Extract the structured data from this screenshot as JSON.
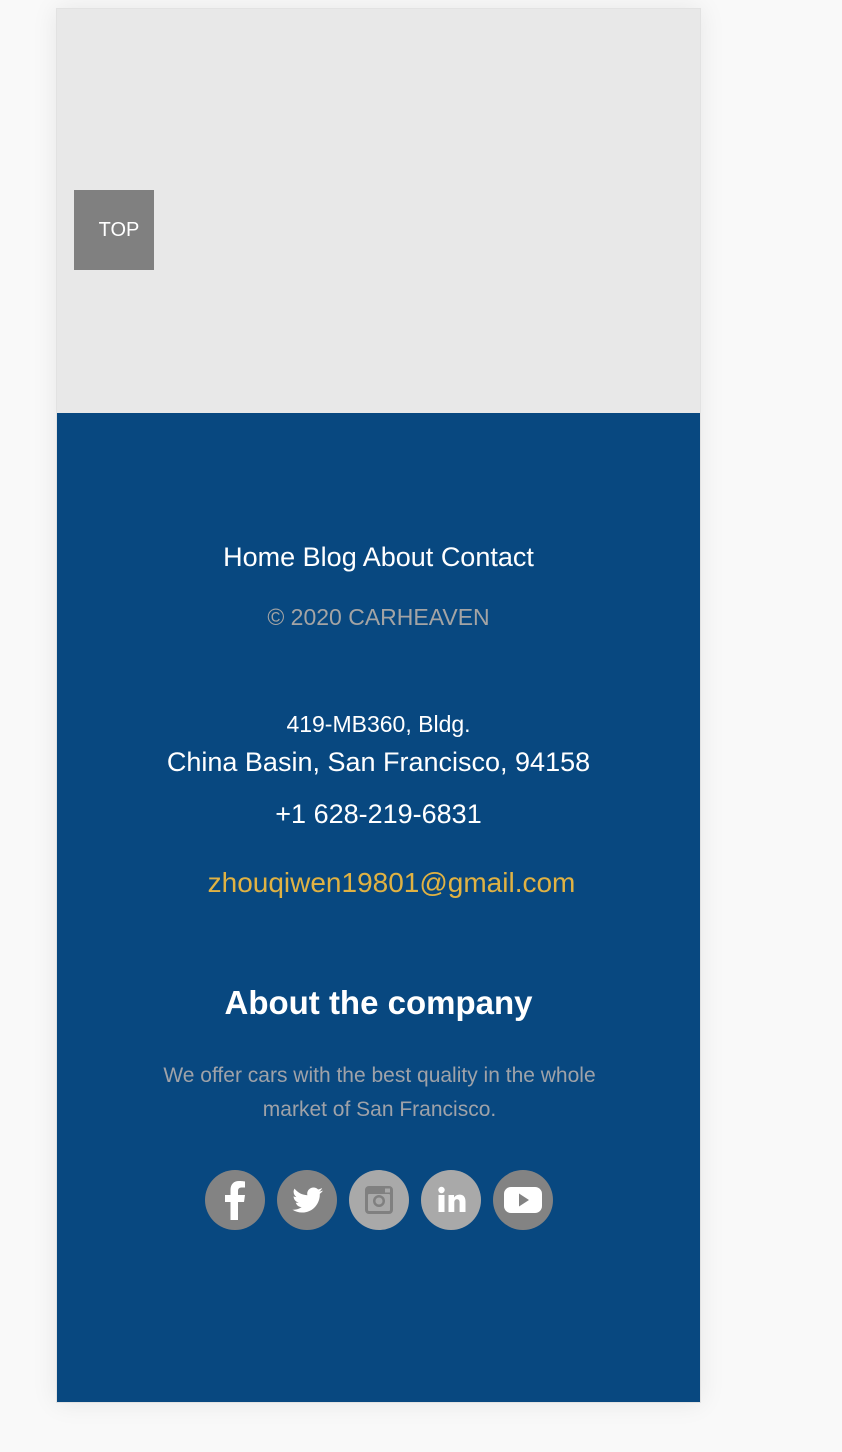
{
  "top_button": {
    "label": "TOP"
  },
  "nav": {
    "items": [
      {
        "label": "Home"
      },
      {
        "label": "Blog"
      },
      {
        "label": "About"
      },
      {
        "label": "Contact"
      }
    ]
  },
  "copyright": "© 2020 CARHEAVEN",
  "address": {
    "line1": "419-MB360, Bldg.",
    "line2": "China Basin, San Francisco, 94158"
  },
  "phone": "+1 628-219-6831",
  "email": "zhouqiwen19801@gmail.com",
  "about": {
    "title": "About the company",
    "text": "We offer cars with the best quality in the whole market of San Francisco."
  },
  "social": [
    {
      "icon": "facebook-icon"
    },
    {
      "icon": "twitter-icon"
    },
    {
      "icon": "instagram-icon"
    },
    {
      "icon": "linkedin-icon"
    },
    {
      "icon": "youtube-icon"
    }
  ],
  "colors": {
    "footer_bg": "#084880",
    "top_area_bg": "#e8e8e8",
    "top_button_bg": "#808080",
    "email": "#e0b243",
    "muted_text": "#a4a4a4",
    "social_icon_bg": "#838383"
  }
}
